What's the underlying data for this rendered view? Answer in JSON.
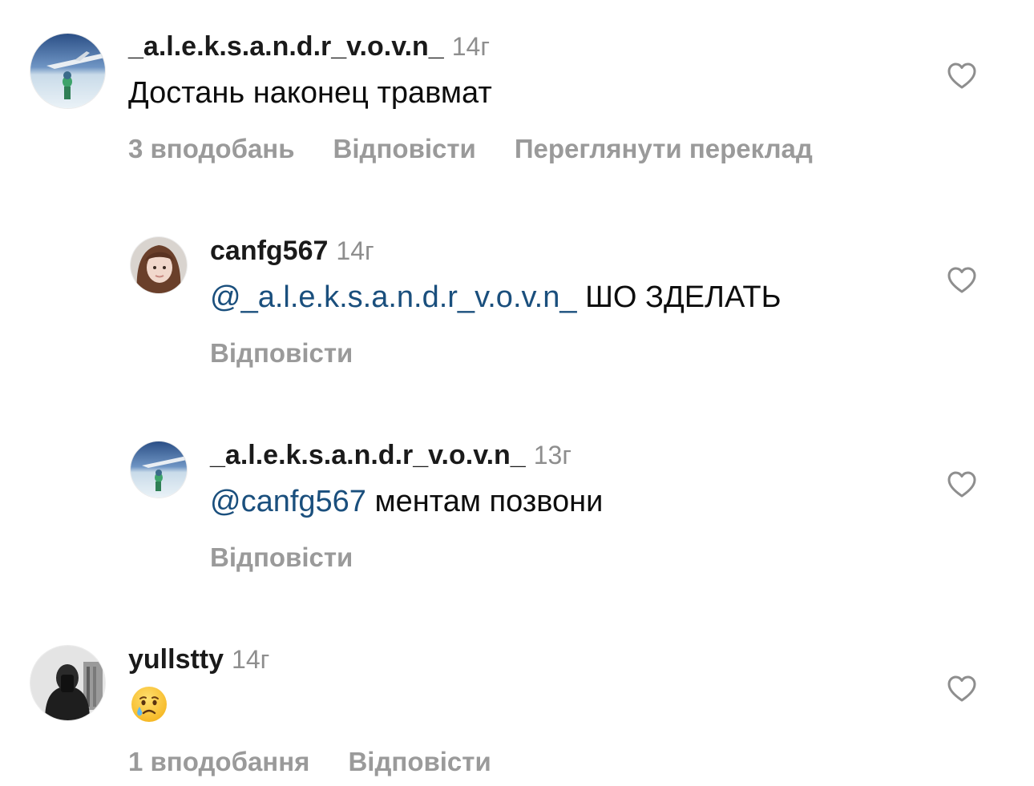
{
  "comments": [
    {
      "username": "_a.l.e.k.s.a.n.d.r_v.o.v.n_",
      "time": "14г",
      "text": "Достань наконец травмат",
      "likes": "3 вподобань",
      "reply": "Відповісти",
      "translate": "Переглянути переклад"
    },
    {
      "username": "canfg567",
      "time": "14г",
      "mention": "@_a.l.e.k.s.a.n.d.r_v.o.v.n_",
      "text": " ШО ЗДЕЛАТЬ",
      "reply": "Відповісти"
    },
    {
      "username": "_a.l.e.k.s.a.n.d.r_v.o.v.n_",
      "time": "13г",
      "mention": "@canfg567",
      "text": " ментам позвони",
      "reply": "Відповісти"
    },
    {
      "username": "yullstty",
      "time": "14г",
      "emoji": "crying-face-emoji",
      "likes": "1 вподобання",
      "reply": "Відповісти"
    }
  ],
  "colors": {
    "mention": "#1a4f7d",
    "secondary": "#8e8e8e",
    "action": "#9a9a9a"
  },
  "icons": {
    "like": "heart-outline-icon"
  }
}
